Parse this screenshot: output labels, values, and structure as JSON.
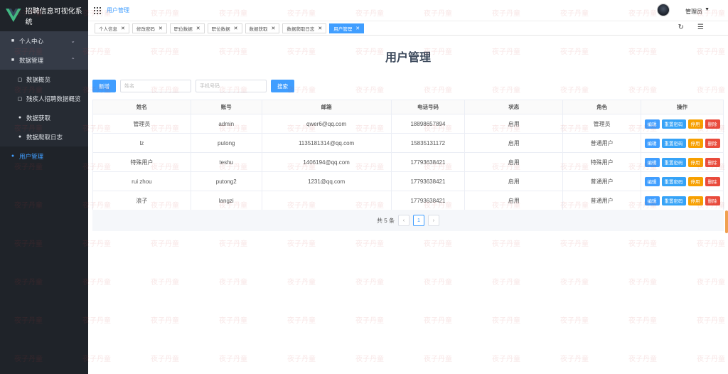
{
  "app": {
    "title": "招聘信息可视化系统"
  },
  "sidebar": {
    "items": [
      {
        "label": "个人中心",
        "icon": "square-icon",
        "kind": "parent",
        "chevron": "⌄"
      },
      {
        "label": "数据管理",
        "icon": "square-icon",
        "kind": "parent",
        "chevron": "⌃"
      },
      {
        "label": "数据概览",
        "icon": "doc-icon",
        "kind": "sub"
      },
      {
        "label": "残疾人招聘数据概览",
        "icon": "doc-icon",
        "kind": "sub"
      },
      {
        "label": "数据获取",
        "icon": "user-icon",
        "kind": "sub"
      },
      {
        "label": "数据爬取日志",
        "icon": "user-icon",
        "kind": "sub"
      },
      {
        "label": "用户管理",
        "icon": "user-icon",
        "kind": "active"
      }
    ]
  },
  "header": {
    "breadcrumb": "用户管理",
    "user": "管理员"
  },
  "tabs": [
    {
      "label": "个人信息",
      "active": false
    },
    {
      "label": "修改密码",
      "active": false
    },
    {
      "label": "职位数据",
      "active": false
    },
    {
      "label": "职位数据",
      "active": false
    },
    {
      "label": "数据获取",
      "active": false
    },
    {
      "label": "数据爬取日志",
      "active": false
    },
    {
      "label": "用户管理",
      "active": true
    }
  ],
  "main": {
    "title": "用户管理",
    "toolbar": {
      "add_label": "新增",
      "name_placeholder": "姓名",
      "phone_placeholder": "手机号码",
      "search_label": "搜索"
    },
    "table": {
      "columns": [
        "姓名",
        "账号",
        "邮箱",
        "电话号码",
        "状态",
        "角色",
        "操作"
      ],
      "rows": [
        [
          "管理员",
          "admin",
          "qwer6@qq.com",
          "18898657894",
          "启用",
          "管理员"
        ],
        [
          "lz",
          "putong",
          "1135181314@qq.com",
          "15835131172",
          "启用",
          "普通用户"
        ],
        [
          "特殊用户",
          "teshu",
          "1406194@qq.com",
          "17793638421",
          "启用",
          "特殊用户"
        ],
        [
          "rui zhou",
          "putong2",
          "1231@qq.com",
          "17793638421",
          "启用",
          "普通用户"
        ],
        [
          "浪子",
          "langzi",
          "",
          "17793638421",
          "启用",
          "普通用户"
        ]
      ],
      "actions": [
        "编辑",
        "重置密码",
        "停用",
        "删除"
      ]
    },
    "pagination": {
      "total": "共 5 条",
      "current": "1",
      "prev": "‹",
      "next": "›"
    }
  },
  "watermark": "夜子丹童"
}
